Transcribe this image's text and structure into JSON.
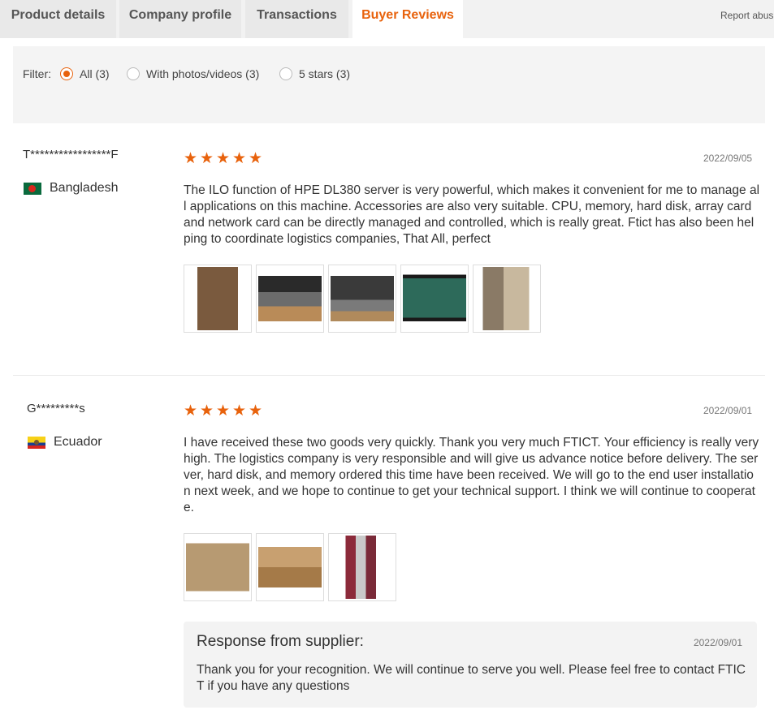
{
  "tabs": [
    {
      "label": "Product details"
    },
    {
      "label": "Company profile"
    },
    {
      "label": "Transactions"
    },
    {
      "label": "Buyer Reviews"
    }
  ],
  "report_link": "Report abus",
  "filter": {
    "label": "Filter:",
    "options": [
      {
        "label": "All (3)",
        "selected": true
      },
      {
        "label": "With photos/videos (3)",
        "selected": false
      },
      {
        "label": "5 stars (3)",
        "selected": false
      }
    ]
  },
  "reviews": [
    {
      "name": "T*****************F",
      "country": "Bangladesh",
      "flag_icon": "bangladesh-flag-icon",
      "rating": 5,
      "date": "2022/09/05",
      "text": "The ILO function of HPE DL380 server is very powerful, which makes it convenient for me to manage all applications on this machine. Accessories are also very suitable. CPU, memory, hard disk, array card and network card can be directly managed and controlled, which is really great. Ftict has also been helping to coordinate logistics companies, That All, perfect",
      "photo_count": 5
    },
    {
      "name": "G*********s",
      "country": "Ecuador",
      "flag_icon": "ecuador-flag-icon",
      "rating": 5,
      "date": "2022/09/01",
      "text": "I have received these two goods very quickly. Thank you very much FTICT. Your efficiency is really very high. The logistics company is very responsible and will give us advance notice before delivery. The server, hard disk, and memory ordered this time have been received. We will go to the end user installation next week, and we hope to continue to get your technical support. I think we will continue to cooperate.",
      "photo_count": 3
    }
  ],
  "response": {
    "title": "Response from supplier:",
    "date": "2022/09/01",
    "text": "Thank you for your recognition. We will continue to serve you well. Please feel free to contact FTICT if you have any questions"
  },
  "colors": {
    "accent": "#e8620c",
    "star": "#e8620c"
  }
}
